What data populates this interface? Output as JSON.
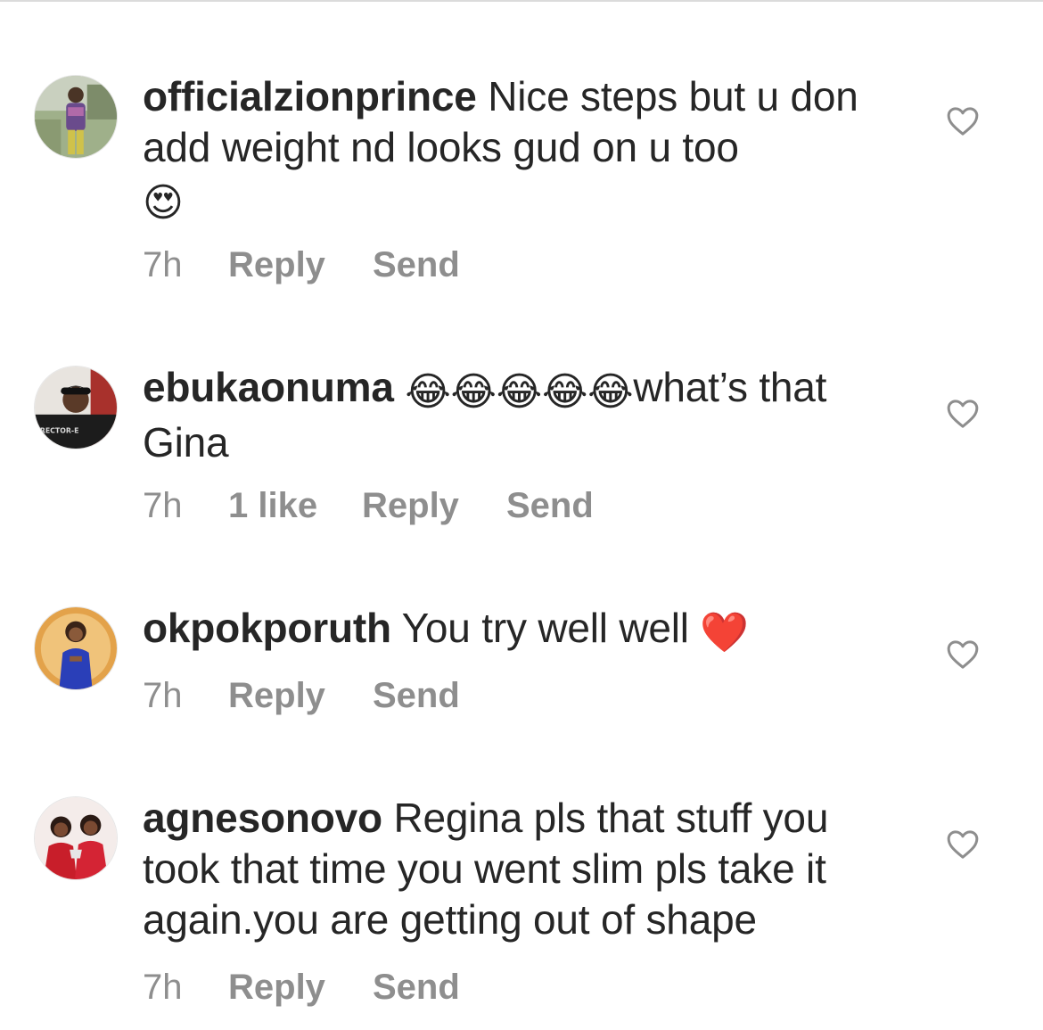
{
  "comments": [
    {
      "username": "officialzionprince",
      "text": " Nice steps but u don add weight nd looks gud on u too ",
      "emoji": "😍",
      "time": "7h",
      "likes": "",
      "reply": "Reply",
      "send": "Send",
      "avatar": "man-standing-avatar"
    },
    {
      "username": "ebukaonuma",
      "text_before": " ",
      "emoji": "😂😂😂😂😂",
      "text": "what’s that Gina",
      "time": "7h",
      "likes": "1 like",
      "reply": "Reply",
      "send": "Send",
      "avatar": "man-cap-avatar",
      "avatar_text": "IRECTOR-E"
    },
    {
      "username": "okpokporuth",
      "text": " You try well well ",
      "emoji": "❤️",
      "time": "7h",
      "likes": "",
      "reply": "Reply",
      "send": "Send",
      "avatar": "woman-blue-dress-avatar"
    },
    {
      "username": "agnesonovo",
      "text": " Regina pls that stuff you took that time you went slim pls take it again.you are getting out of shape",
      "time": "7h",
      "likes": "",
      "reply": "Reply",
      "send": "Send",
      "avatar": "two-women-red-avatar"
    }
  ],
  "colors": {
    "text": "#262626",
    "meta": "#8e8e8e",
    "heart_outline": "#8e8e8e",
    "red_heart": "#e0202f"
  },
  "icons": {
    "like": "heart-outline-icon"
  }
}
